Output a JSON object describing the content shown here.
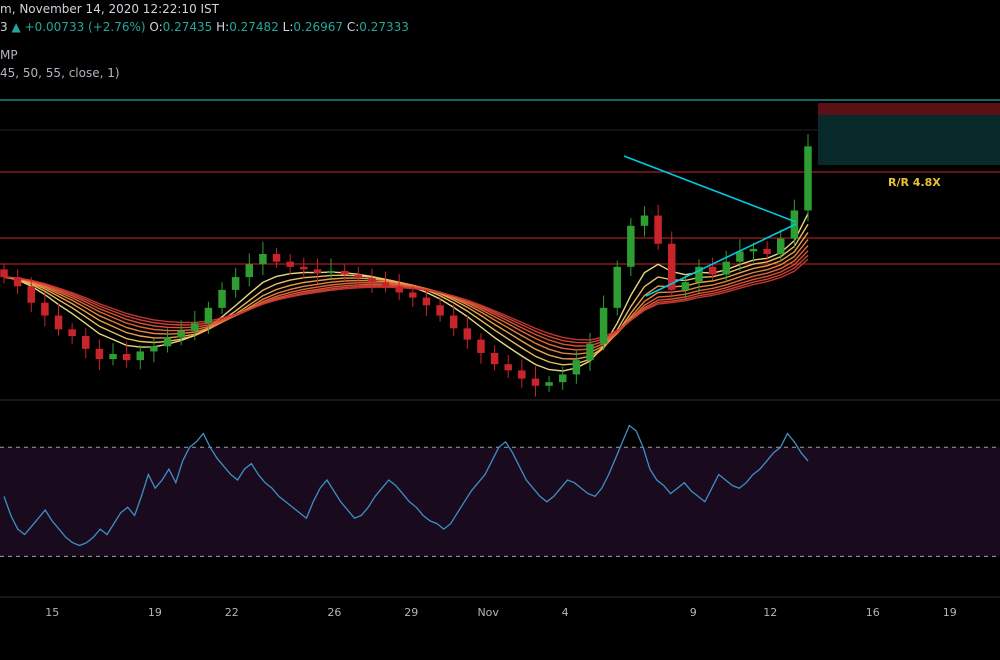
{
  "header": {
    "line1": "m, November 14, 2020 12:22:10 IST",
    "price_tail": "3",
    "arrow": "▲",
    "change": "+0.00733 (+2.76%)",
    "o_label": "O:",
    "o_val": "0.27435",
    "h_label": "H:",
    "h_val": "0.27482",
    "l_label": "L:",
    "l_val": "0.26967",
    "c_label": "C:",
    "c_val": "0.27333",
    "indicator_fragment": "MP",
    "indicator_params": "45, 50, 55, close, 1)"
  },
  "annotation": {
    "rr_label": "R/R 4.8X"
  },
  "colors": {
    "background": "#000000",
    "up": "#26a69a",
    "candle_up": "#2e9e33",
    "candle_down": "#c8242c",
    "hline": "#c8242c",
    "triangle": "#00c8e0",
    "rsi": "#3d8fc6",
    "rsi_band": "#1a0a1e",
    "rr_text": "#e8c234"
  },
  "chart_data": [
    {
      "type": "candlestick",
      "title": "",
      "x_tick_labels": [
        "15",
        "19",
        "22",
        "26",
        "29",
        "Nov",
        "4",
        "9",
        "12",
        "16",
        "19"
      ],
      "x_ticks_dates": [
        "2020-10-15",
        "2020-10-19",
        "2020-10-22",
        "2020-10-26",
        "2020-10-29",
        "2020-11-01",
        "2020-11-04",
        "2020-11-09",
        "2020-11-12",
        "2020-11-16",
        "2020-11-19"
      ],
      "ribbon": "moving-average ribbon (yellow to red), periods including 45, 50, 55",
      "closes_approx": [
        0.248,
        0.2462,
        0.243,
        0.2405,
        0.2378,
        0.2365,
        0.234,
        0.232,
        0.233,
        0.2318,
        0.2335,
        0.2345,
        0.2362,
        0.2375,
        0.239,
        0.242,
        0.2455,
        0.248,
        0.2505,
        0.2525,
        0.251,
        0.25,
        0.2495,
        0.2488,
        0.2492,
        0.2485,
        0.2478,
        0.247,
        0.2462,
        0.245,
        0.244,
        0.2425,
        0.2405,
        0.238,
        0.2358,
        0.2332,
        0.231,
        0.2298,
        0.2282,
        0.2268,
        0.2275,
        0.229,
        0.2318,
        0.235,
        0.242,
        0.25,
        0.258,
        0.26,
        0.2545,
        0.2455,
        0.247,
        0.25,
        0.2485,
        0.251,
        0.253,
        0.2535,
        0.2525,
        0.2555,
        0.261,
        0.2735
      ],
      "horizontal_levels": "four red support/resistance lines and a cyan top line",
      "patterns": [
        "symmetrical triangle (cyan)"
      ],
      "position_box": "risk/reward box",
      "annotations": [
        "R/R 4.8X"
      ]
    },
    {
      "type": "line",
      "title": "",
      "series": [
        {
          "values": [
            52,
            45,
            40,
            38,
            41,
            44,
            47,
            43,
            40,
            37,
            35,
            34,
            35,
            37,
            40,
            38,
            42,
            46,
            48,
            45,
            52,
            60,
            55,
            58,
            62,
            57,
            65,
            70,
            72,
            75,
            70,
            66,
            63,
            60,
            58,
            62,
            64,
            60,
            57,
            55,
            52,
            50,
            48,
            46,
            44,
            50,
            55,
            58,
            54,
            50,
            47,
            44,
            45,
            48,
            52,
            55,
            58,
            56,
            53,
            50,
            48,
            45,
            43,
            42,
            40,
            42,
            46,
            50,
            54,
            57,
            60,
            65,
            70,
            72,
            68,
            63,
            58,
            55,
            52,
            50,
            52,
            55,
            58,
            57,
            55,
            53,
            52,
            55,
            60,
            66,
            72,
            78,
            76,
            70,
            62,
            58,
            56,
            53,
            55,
            57,
            54,
            52,
            50,
            55,
            60,
            58,
            56,
            55,
            57,
            60,
            62,
            65,
            68,
            70,
            75,
            72,
            68,
            65
          ]
        }
      ],
      "overbought_level": 70,
      "oversold_level": 30,
      "ylim": [
        25,
        80
      ]
    }
  ]
}
